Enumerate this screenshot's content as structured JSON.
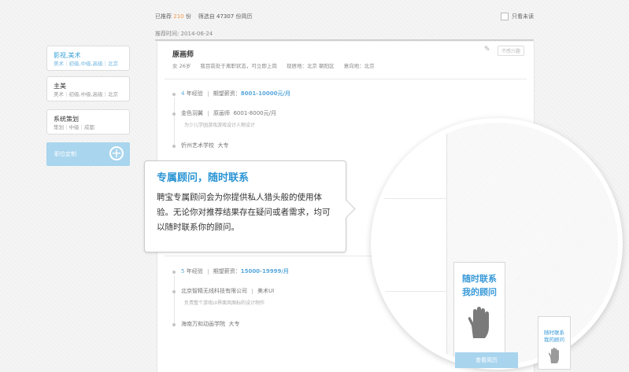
{
  "sidebar": {
    "cards": [
      {
        "title": "影视,美术",
        "sub": "美术｜初级,中级,高级｜北京",
        "active": true
      },
      {
        "title": "主美",
        "sub": "美术｜初级,中级,高级｜北京",
        "active": false
      },
      {
        "title": "系统策划",
        "sub": "策划｜中级｜成都",
        "active": false
      }
    ],
    "custom_label": "职位定制"
  },
  "stats": {
    "recommended_label": "已推荐",
    "recommended_count": "210",
    "recommended_unit": "份",
    "screened_label": "筛选自",
    "screened_count": "47307",
    "screened_unit": "份简历"
  },
  "unread_label": "只看未读",
  "recommend_time": "推荐时间: 2014-06-24",
  "resume1": {
    "title": "原画师",
    "meta": [
      "女 26岁",
      "我目前处于离职状态，可立即上岗",
      "现居地：北京 朝阳区",
      "意向地：北京"
    ],
    "disinterest": "不感兴趣",
    "exp_years": "4",
    "exp_label": "年经验",
    "salary_label": "期望薪资：",
    "salary": "8001-10000元/月",
    "company": "金色羽翼",
    "position": "原画师",
    "pos_salary": "6001-8000元/月",
    "desc": "为少儿学园游戏游戏设计人物设计",
    "school": "忻州艺术学校",
    "degree": "大专"
  },
  "resume2": {
    "exp_years": "5",
    "exp_label": "年经验",
    "salary_label": "期望薪资：",
    "salary": "15000-19999/月",
    "company": "北京智精无线科技有限公司",
    "position": "美术UI",
    "desc": "负责整个游戏UI界面风图标的设计制作",
    "school": "海南万和动画学院",
    "degree": "大专"
  },
  "tooltip": {
    "title": "专属顾问，随时联系",
    "body": "聘宝专属顾问会为你提供私人猎头般的使用体验。无论你对推荐结果存在疑问或者需求，均可以随时联系你的顾问。"
  },
  "contact": {
    "line1": "随时联系",
    "line2": "我的顾问"
  },
  "view_resume": "查看简历"
}
